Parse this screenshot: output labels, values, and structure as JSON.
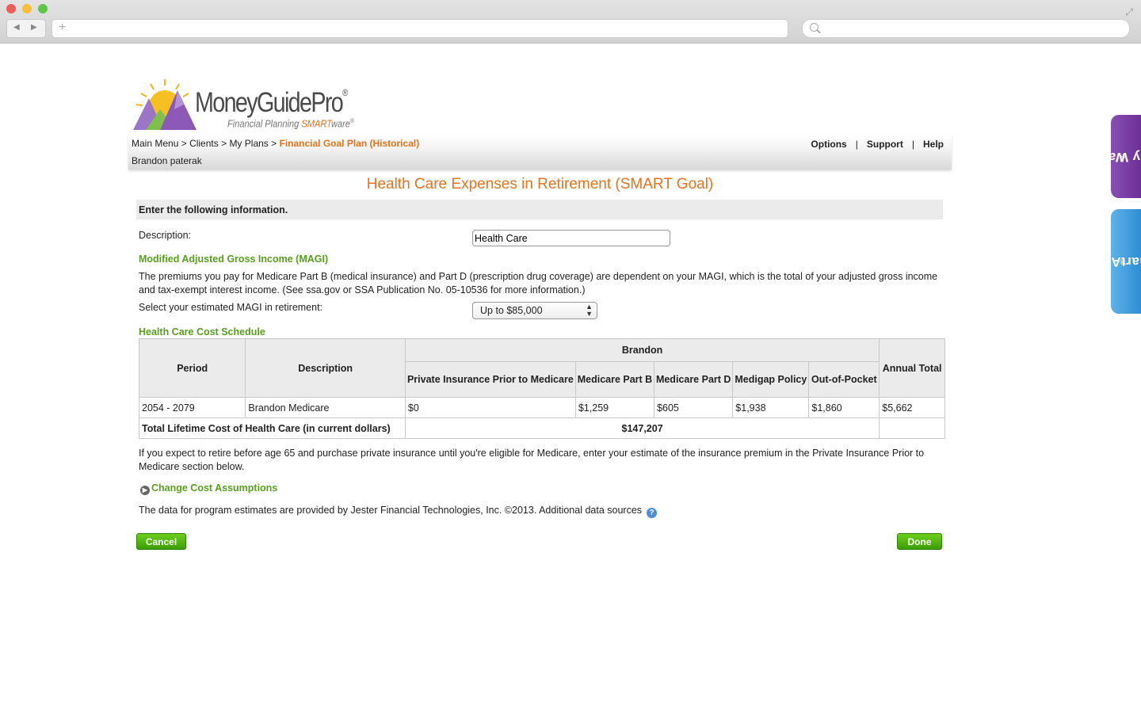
{
  "browser": {
    "url": "",
    "search_placeholder": ""
  },
  "logo": {
    "name": "MoneyGuidePro",
    "reg": "®",
    "tagline_prefix": "Financial Planning ",
    "tagline_smart": "SMART",
    "tagline_suffix": "ware",
    "tagline_reg": "®"
  },
  "breadcrumb": {
    "items": [
      "Main Menu",
      "Clients",
      "My Plans"
    ],
    "separator": " > ",
    "current": "Financial Goal Plan (Historical)"
  },
  "client_name": "Brandon paterak",
  "top_links": [
    "Options",
    "Support",
    "Help"
  ],
  "page_title": "Health Care Expenses in Retirement (SMART Goal)",
  "enter_info": "Enter the following information.",
  "description": {
    "label": "Description:",
    "value": "Health Care"
  },
  "magi": {
    "heading": "Modified Adjusted Gross Income (MAGI)",
    "text": "The premiums you pay for Medicare Part B (medical insurance) and Part D (prescription drug coverage) are dependent on your MAGI, which is the total of your adjusted gross income and tax-exempt interest income. (See ssa.gov or SSA Publication No. 05-10536 for more information.)",
    "select_label": "Select your estimated MAGI in retirement:",
    "select_value": "Up to $85,000"
  },
  "schedule": {
    "heading": "Health Care Cost Schedule",
    "group_header": "Brandon",
    "headers": {
      "period": "Period",
      "description": "Description",
      "private": "Private Insurance Prior to Medicare",
      "part_b": "Medicare Part B",
      "part_d": "Medicare Part D",
      "medigap": "Medigap Policy",
      "oop": "Out-of-Pocket",
      "annual": "Annual Total"
    },
    "row": {
      "period": "2054 - 2079",
      "description": "Brandon Medicare",
      "private": "$0",
      "part_b": "$1,259",
      "part_d": "$605",
      "medigap": "$1,938",
      "oop": "$1,860",
      "annual": "$5,662"
    },
    "total_label": "Total Lifetime Cost of Health Care (in current dollars)",
    "total_value": "$147,207"
  },
  "retire_note": "If you expect to retire before age 65 and purchase private insurance until you're eligible for Medicare, enter your estimate of the insurance premium in the Private Insurance Prior to Medicare section below.",
  "change_link": "Change Cost Assumptions",
  "data_source": "The data for program estimates are provided by Jester Financial Technologies, Inc. ©2013. Additional data sources",
  "buttons": {
    "cancel": "Cancel",
    "done": "Done"
  },
  "side_tabs": {
    "my_way": "My Way",
    "smart_alex": "SmartAlex",
    "reg": "®"
  },
  "colors": {
    "accent_orange": "#e8731c",
    "green": "#5a9e1f",
    "button_green": "#4fb40e",
    "my_way_purple": "#7a3fa6",
    "smart_alex_blue": "#3f9ddf"
  }
}
